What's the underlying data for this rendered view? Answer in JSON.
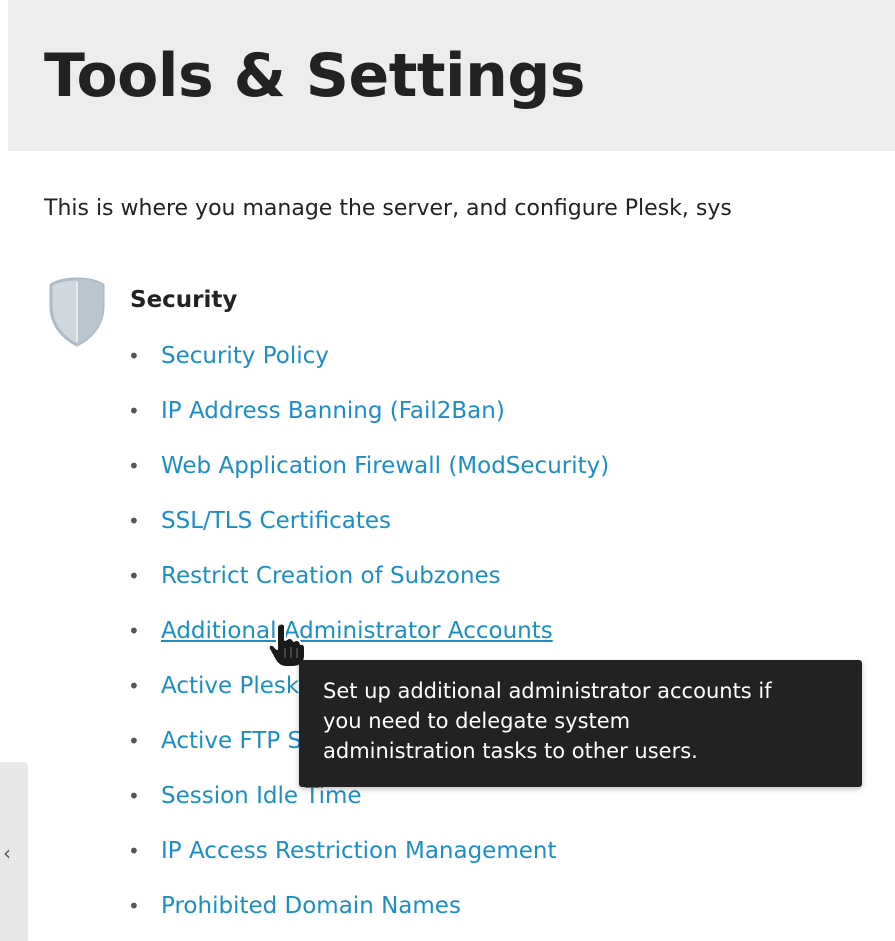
{
  "page": {
    "title": "Tools & Settings",
    "intro": "This is where you manage the server, and configure Plesk, sys"
  },
  "security": {
    "icon": "shield-icon",
    "title": "Security",
    "links": [
      {
        "label": "Security Policy",
        "hovered": false
      },
      {
        "label": "IP Address Banning (Fail2Ban)",
        "hovered": false
      },
      {
        "label": "Web Application Firewall (ModSecurity)",
        "hovered": false
      },
      {
        "label": "SSL/TLS Certificates",
        "hovered": false
      },
      {
        "label": "Restrict Creation of Subzones",
        "hovered": false
      },
      {
        "label": "Additional Administrator Accounts",
        "hovered": true
      },
      {
        "label": "Active Plesk Sessions",
        "hovered": false
      },
      {
        "label": "Active FTP Sessions",
        "hovered": false
      },
      {
        "label": "Session Idle Time",
        "hovered": false
      },
      {
        "label": "IP Access Restriction Management",
        "hovered": false
      },
      {
        "label": "Prohibited Domain Names",
        "hovered": false
      }
    ]
  },
  "tooltip": {
    "lines": [
      "Set up additional administrator accounts if",
      "you need to delegate system",
      "administration tasks to other users."
    ]
  },
  "side_panel": {
    "chevron": "‹",
    "icon": "chevron-left-icon"
  },
  "colors": {
    "link": "#1c8ec6",
    "header_bg": "#ededed",
    "tooltip_bg": "#222222",
    "text": "#222222"
  }
}
